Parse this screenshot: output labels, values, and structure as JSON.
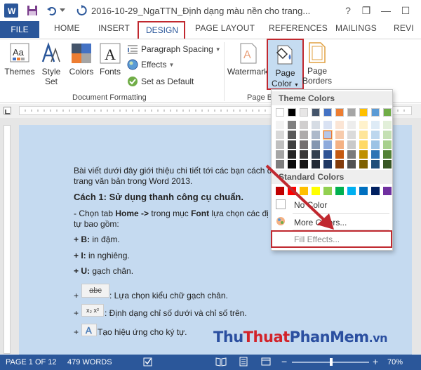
{
  "title_bar": {
    "title": "2016-10-29_NgaTTN_Định dạng màu nền cho trang...",
    "help": "?",
    "restore": "❐",
    "minimize": "—",
    "maximize": "☐"
  },
  "tabs": {
    "file": "FILE",
    "home": "HOME",
    "insert": "INSERT",
    "design": "DESIGN",
    "page_layout": "PAGE LAYOUT",
    "references": "REFERENCES",
    "mailings": "MAILINGS",
    "review": "REVI"
  },
  "ribbon": {
    "themes": "Themes",
    "style_set_1": "Style",
    "style_set_2": "Set",
    "colors": "Colors",
    "fonts": "Fonts",
    "paragraph_spacing": "Paragraph Spacing",
    "effects": "Effects",
    "set_as_default": "Set as Default",
    "document_formatting": "Document Formatting",
    "watermark": "Watermark",
    "page_color_1": "Page",
    "page_color_2": "Color",
    "page_borders_1": "Page",
    "page_borders_2": "Borders",
    "page_background_group": "Page B",
    "fonts_icon_letter": "A",
    "themes_icon_letters": "Aa"
  },
  "document": {
    "line1": "Bài viết dưới đây giới thiệu chi tiết tới các bạn cách đ",
    "line2": "trang văn bản trong Word 2013.",
    "heading": "Cách 1: Sử dụng thanh công cụ chuẩn.",
    "line3_prefix": "- Chọn tab ",
    "line3_bold1": "Home ->",
    "line3_mid": " trong mục ",
    "line3_bold2": "Font",
    "line3_rest": " lựa chọn các đị",
    "line4": "tự bao gồm:",
    "bold_label": "+ B:",
    "bold_desc": " in đậm.",
    "italic_label": "+ I:",
    "italic_desc": " in nghiêng.",
    "underline_label": "+ U:",
    "underline_desc": " gạch chân.",
    "strike_desc": ": Lựa chọn kiểu chữ gạch chân.",
    "strike_icon_text": "abc",
    "subsup_desc": ": Định dạng chỉ số dưới và chỉ số trên.",
    "subsup_icon_text": "x₂ x²",
    "effect_desc": " Tạo hiệu ứng cho ký tự.",
    "plus": "+"
  },
  "page_color_menu": {
    "theme_colors": "Theme Colors",
    "standard_colors": "Standard Colors",
    "no_color": "No Color",
    "more_colors": "More Colors...",
    "fill_effects": "Fill Effects...",
    "theme_top": [
      "#ffffff",
      "#000000",
      "#e7e6e6",
      "#44546a",
      "#4472c4",
      "#ed7d31",
      "#a5a5a5",
      "#ffc000",
      "#5b9bd5",
      "#70ad47"
    ],
    "theme_shades": [
      [
        "#f2f2f2",
        "#7f7f7f",
        "#d0cece",
        "#d6dce4",
        "#d9e2f3",
        "#fbe5d5",
        "#ededed",
        "#fff2cc",
        "#deebf6",
        "#e2efd9"
      ],
      [
        "#d8d8d8",
        "#595959",
        "#aeabab",
        "#adb9ca",
        "#b4c6e7",
        "#f7cbac",
        "#dbdbdb",
        "#fee599",
        "#bdd7ee",
        "#c5e0b3"
      ],
      [
        "#bfbfbf",
        "#3f3f3f",
        "#757070",
        "#8496b0",
        "#8eaadb",
        "#f4b183",
        "#c9c9c9",
        "#ffd965",
        "#9cc3e5",
        "#a8d08d"
      ],
      [
        "#a5a5a5",
        "#262626",
        "#3a3838",
        "#323f4f",
        "#2f5496",
        "#c55a11",
        "#7b7b7b",
        "#bf9000",
        "#2e75b5",
        "#538135"
      ],
      [
        "#7f7f7f",
        "#0c0c0c",
        "#171616",
        "#222a35",
        "#1f3864",
        "#833c0b",
        "#525252",
        "#7f6000",
        "#1e4e79",
        "#375623"
      ]
    ],
    "standard": [
      "#c00000",
      "#ff0000",
      "#ffc000",
      "#ffff00",
      "#92d050",
      "#00b050",
      "#00b0f0",
      "#0070c0",
      "#002060",
      "#7030a0"
    ]
  },
  "status_bar": {
    "page": "PAGE 1 OF 12",
    "words": "479 WORDS",
    "zoom_minus": "−",
    "zoom_plus": "+",
    "zoom": "70%"
  },
  "watermark_logo": {
    "part1": "Thu",
    "part2": "Thuat",
    "part3": "PhanMem",
    "part4": ".vn"
  },
  "colors": {
    "accent": "#2b579a",
    "highlight_red": "#c0282f",
    "page_blue": "#c5daf0"
  }
}
